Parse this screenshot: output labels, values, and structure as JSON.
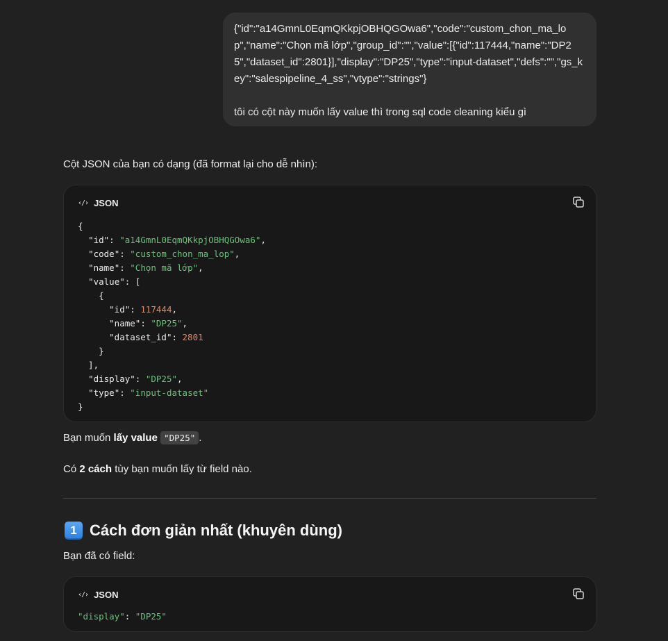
{
  "user_message": {
    "json_text": "{\"id\":\"a14GmnL0EqmQKkpjOBHQGOwa6\",\"code\":\"custom_chon_ma_lop\",\"name\":\"Chọn mã lớp\",\"group_id\":\"\",\"value\":[{\"id\":117444,\"name\":\"DP25\",\"dataset_id\":2801}],\"display\":\"DP25\",\"type\":\"input-dataset\",\"defs\":\"\",\"gs_key\":\"salespipeline_4_ss\",\"vtype\":\"strings\"}",
    "question": "tôi có cột này muốn lấy value thì trong sql code cleaning kiểu gì"
  },
  "assistant": {
    "intro": "Cột JSON của bạn có dạng (đã format lại cho dễ nhìn):",
    "code_block_1": {
      "language": "JSON",
      "icon": "code-icon",
      "copy_icon": "copy-icon",
      "lines": {
        "l1": "{",
        "id_key": "\"id\"",
        "id_val": "\"a14GmnL0EqmQKkpjOBHQGOwa6\"",
        "code_key": "\"code\"",
        "code_val": "\"custom_chon_ma_lop\"",
        "name_key": "\"name\"",
        "name_val": "\"Chọn mã lớp\"",
        "value_key": "\"value\"",
        "inner_id_key": "\"id\"",
        "inner_id_val": "117444",
        "inner_name_key": "\"name\"",
        "inner_name_val": "\"DP25\"",
        "inner_dataset_key": "\"dataset_id\"",
        "inner_dataset_val": "2801",
        "display_key": "\"display\"",
        "display_val": "\"DP25\"",
        "type_key": "\"type\"",
        "type_val": "\"input-dataset\""
      }
    },
    "want_value_prefix": "Bạn muốn ",
    "want_value_bold": "lấy value",
    "want_value_code": "\"DP25\"",
    "want_value_suffix": ".",
    "ways_prefix": "Có ",
    "ways_bold": "2 cách",
    "ways_suffix": " tùy bạn muốn lấy từ field nào.",
    "section_1": {
      "number": "1",
      "title": "Cách đơn giản nhất (khuyên dùng)"
    },
    "has_field": "Bạn đã có field:",
    "code_block_2": {
      "language": "JSON",
      "key": "\"display\"",
      "val": "\"DP25\""
    }
  },
  "colors": {
    "background": "#212121",
    "bubble": "#303030",
    "code_bg": "#181818",
    "string": "#68c37a",
    "number": "#f0825e"
  }
}
